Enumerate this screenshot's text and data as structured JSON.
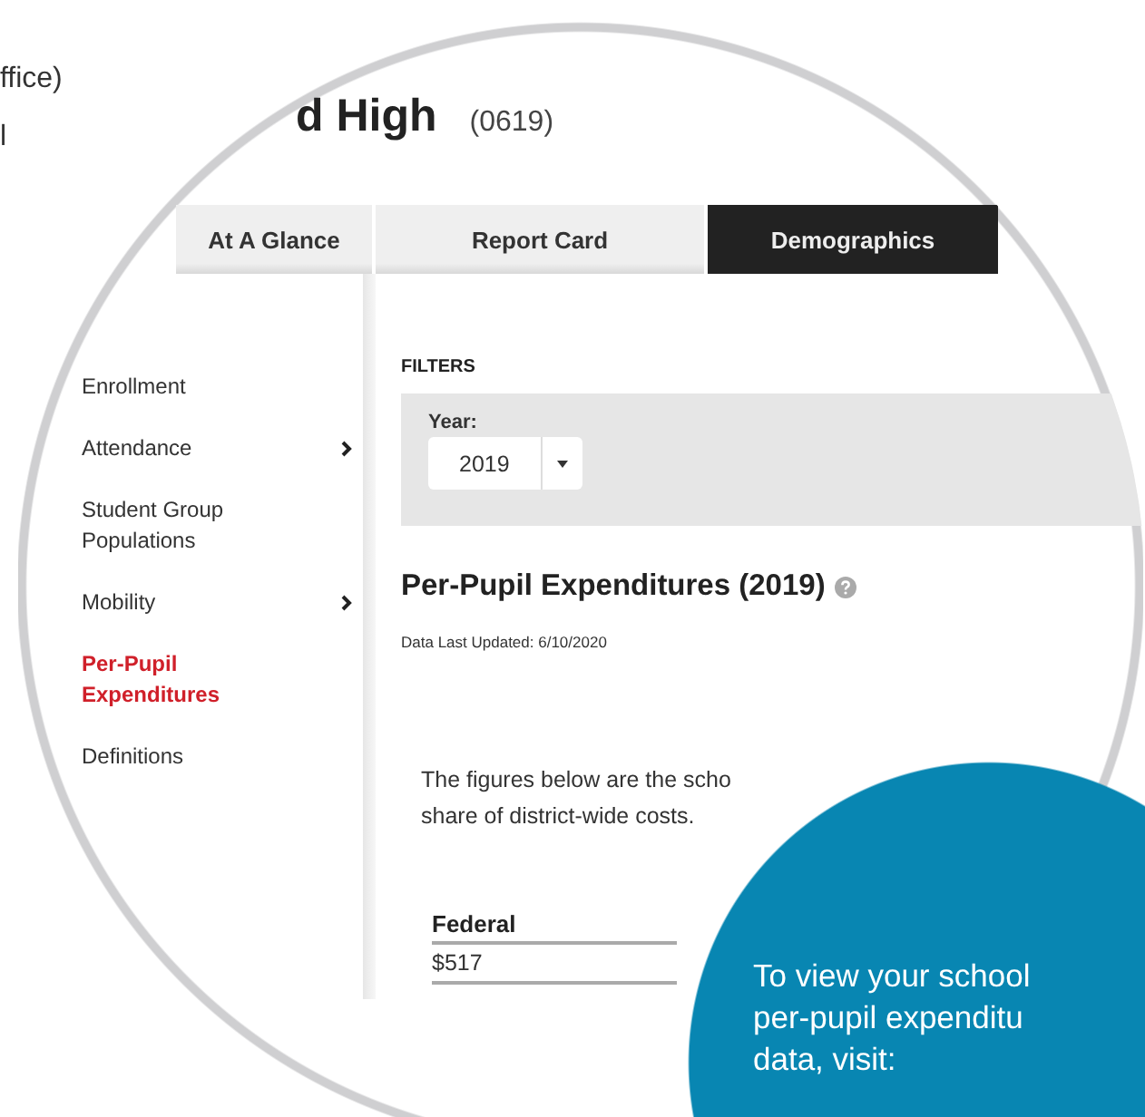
{
  "outside_text": [
    "ffice)",
    "l"
  ],
  "header": {
    "title": "d High",
    "code": "(0619)"
  },
  "tabs": [
    {
      "label": "At A Glance",
      "selected": false
    },
    {
      "label": "Report Card",
      "selected": false
    },
    {
      "label": "Demographics",
      "selected": true
    }
  ],
  "sidebar": {
    "items": [
      {
        "label": "Enrollment",
        "selected": false,
        "expandable": false
      },
      {
        "label": "Attendance",
        "selected": false,
        "expandable": true
      },
      {
        "label": "Student Group Populations",
        "selected": false,
        "expandable": false
      },
      {
        "label": "Mobility",
        "selected": false,
        "expandable": true
      },
      {
        "label": "Per-Pupil Expenditures",
        "selected": true,
        "expandable": false
      },
      {
        "label": "Definitions",
        "selected": false,
        "expandable": false
      }
    ]
  },
  "filters": {
    "heading": "FILTERS",
    "year_label": "Year:",
    "year_value": "2019"
  },
  "section": {
    "title": "Per-Pupil Expenditures (2019)",
    "updated": "Data Last Updated: 6/10/2020",
    "intro_lines": [
      "The figures below are the scho",
      "share of district-wide costs."
    ],
    "table": {
      "columns": [
        "Federal"
      ],
      "rows": [
        [
          "$517"
        ]
      ]
    }
  },
  "callout": {
    "lines": [
      "To view your school",
      "per-pupil expenditu",
      "data, visit:"
    ]
  }
}
